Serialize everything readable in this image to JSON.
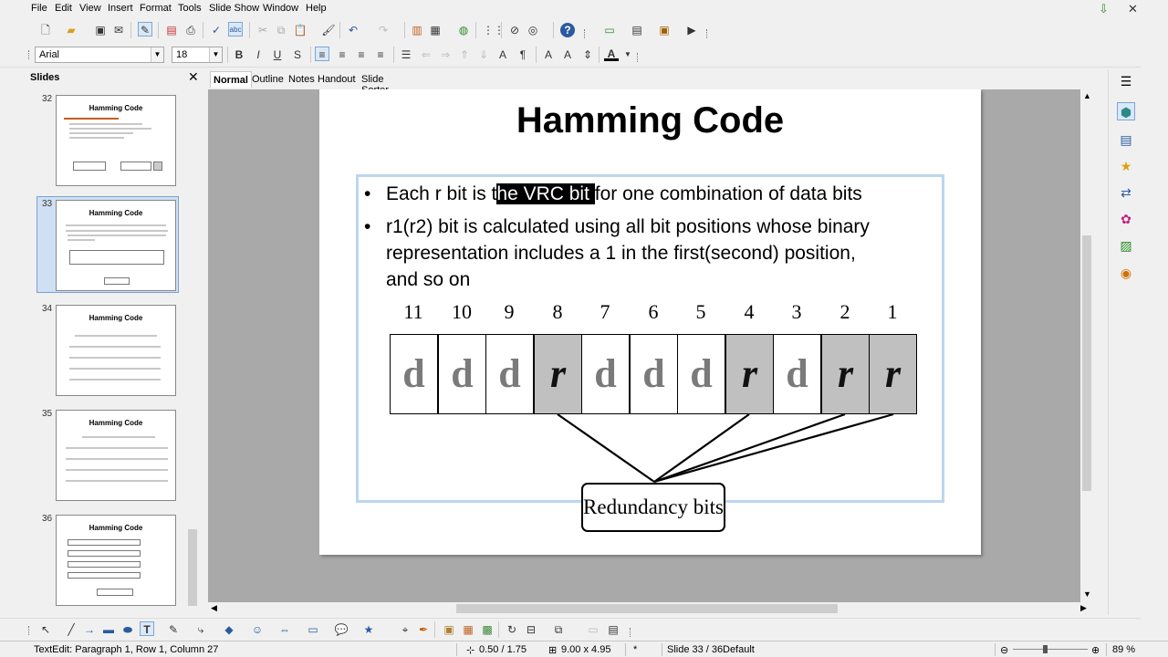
{
  "menubar": {
    "items": [
      "File",
      "Edit",
      "View",
      "Insert",
      "Format",
      "Tools",
      "Slide Show",
      "Window",
      "Help"
    ]
  },
  "format_toolbar": {
    "font_name": "Arial",
    "font_size": "18"
  },
  "slides_pane": {
    "title": "Slides",
    "thumbnails": [
      {
        "number": "32",
        "title": "Hamming Code",
        "selected": false
      },
      {
        "number": "33",
        "title": "Hamming Code",
        "selected": true
      },
      {
        "number": "34",
        "title": "Hamming Code",
        "selected": false
      },
      {
        "number": "35",
        "title": "Hamming Code",
        "selected": false
      },
      {
        "number": "36",
        "title": "Hamming Code",
        "selected": false
      }
    ]
  },
  "view_tabs": [
    "Normal",
    "Outline",
    "Notes",
    "Handout",
    "Slide Sorter"
  ],
  "slide": {
    "title": "Hamming Code",
    "bullet1": {
      "before": "Each r bit is t",
      "selected": "he VRC bit ",
      "after": "for one combination of data bits"
    },
    "bullet2_lines": [
      "r1(r2) bit is calculated using all bit positions whose binary",
      "representation includes a 1 in the first(second) position,",
      "and so on"
    ],
    "diagram": {
      "positions": [
        "11",
        "10",
        "9",
        "8",
        "7",
        "6",
        "5",
        "4",
        "3",
        "2",
        "1"
      ],
      "bits": [
        "d",
        "d",
        "d",
        "r",
        "d",
        "d",
        "d",
        "r",
        "d",
        "r",
        "r"
      ],
      "box_label": "Redundancy bits"
    }
  },
  "statusbar": {
    "edit_status": "TextEdit: Paragraph 1, Row 1, Column 27",
    "position": "0.50 / 1.75",
    "size": "9.00 x 4.95",
    "modified": "*",
    "slide": "Slide 33 / 36",
    "layout": "Default",
    "zoom": "89 %"
  },
  "colors": {
    "selection_bg": "#000000",
    "textbox_border": "#bcd6ee",
    "redundancy_cell": "#c0c0c0",
    "workspace_bg": "#a9a9a9"
  }
}
